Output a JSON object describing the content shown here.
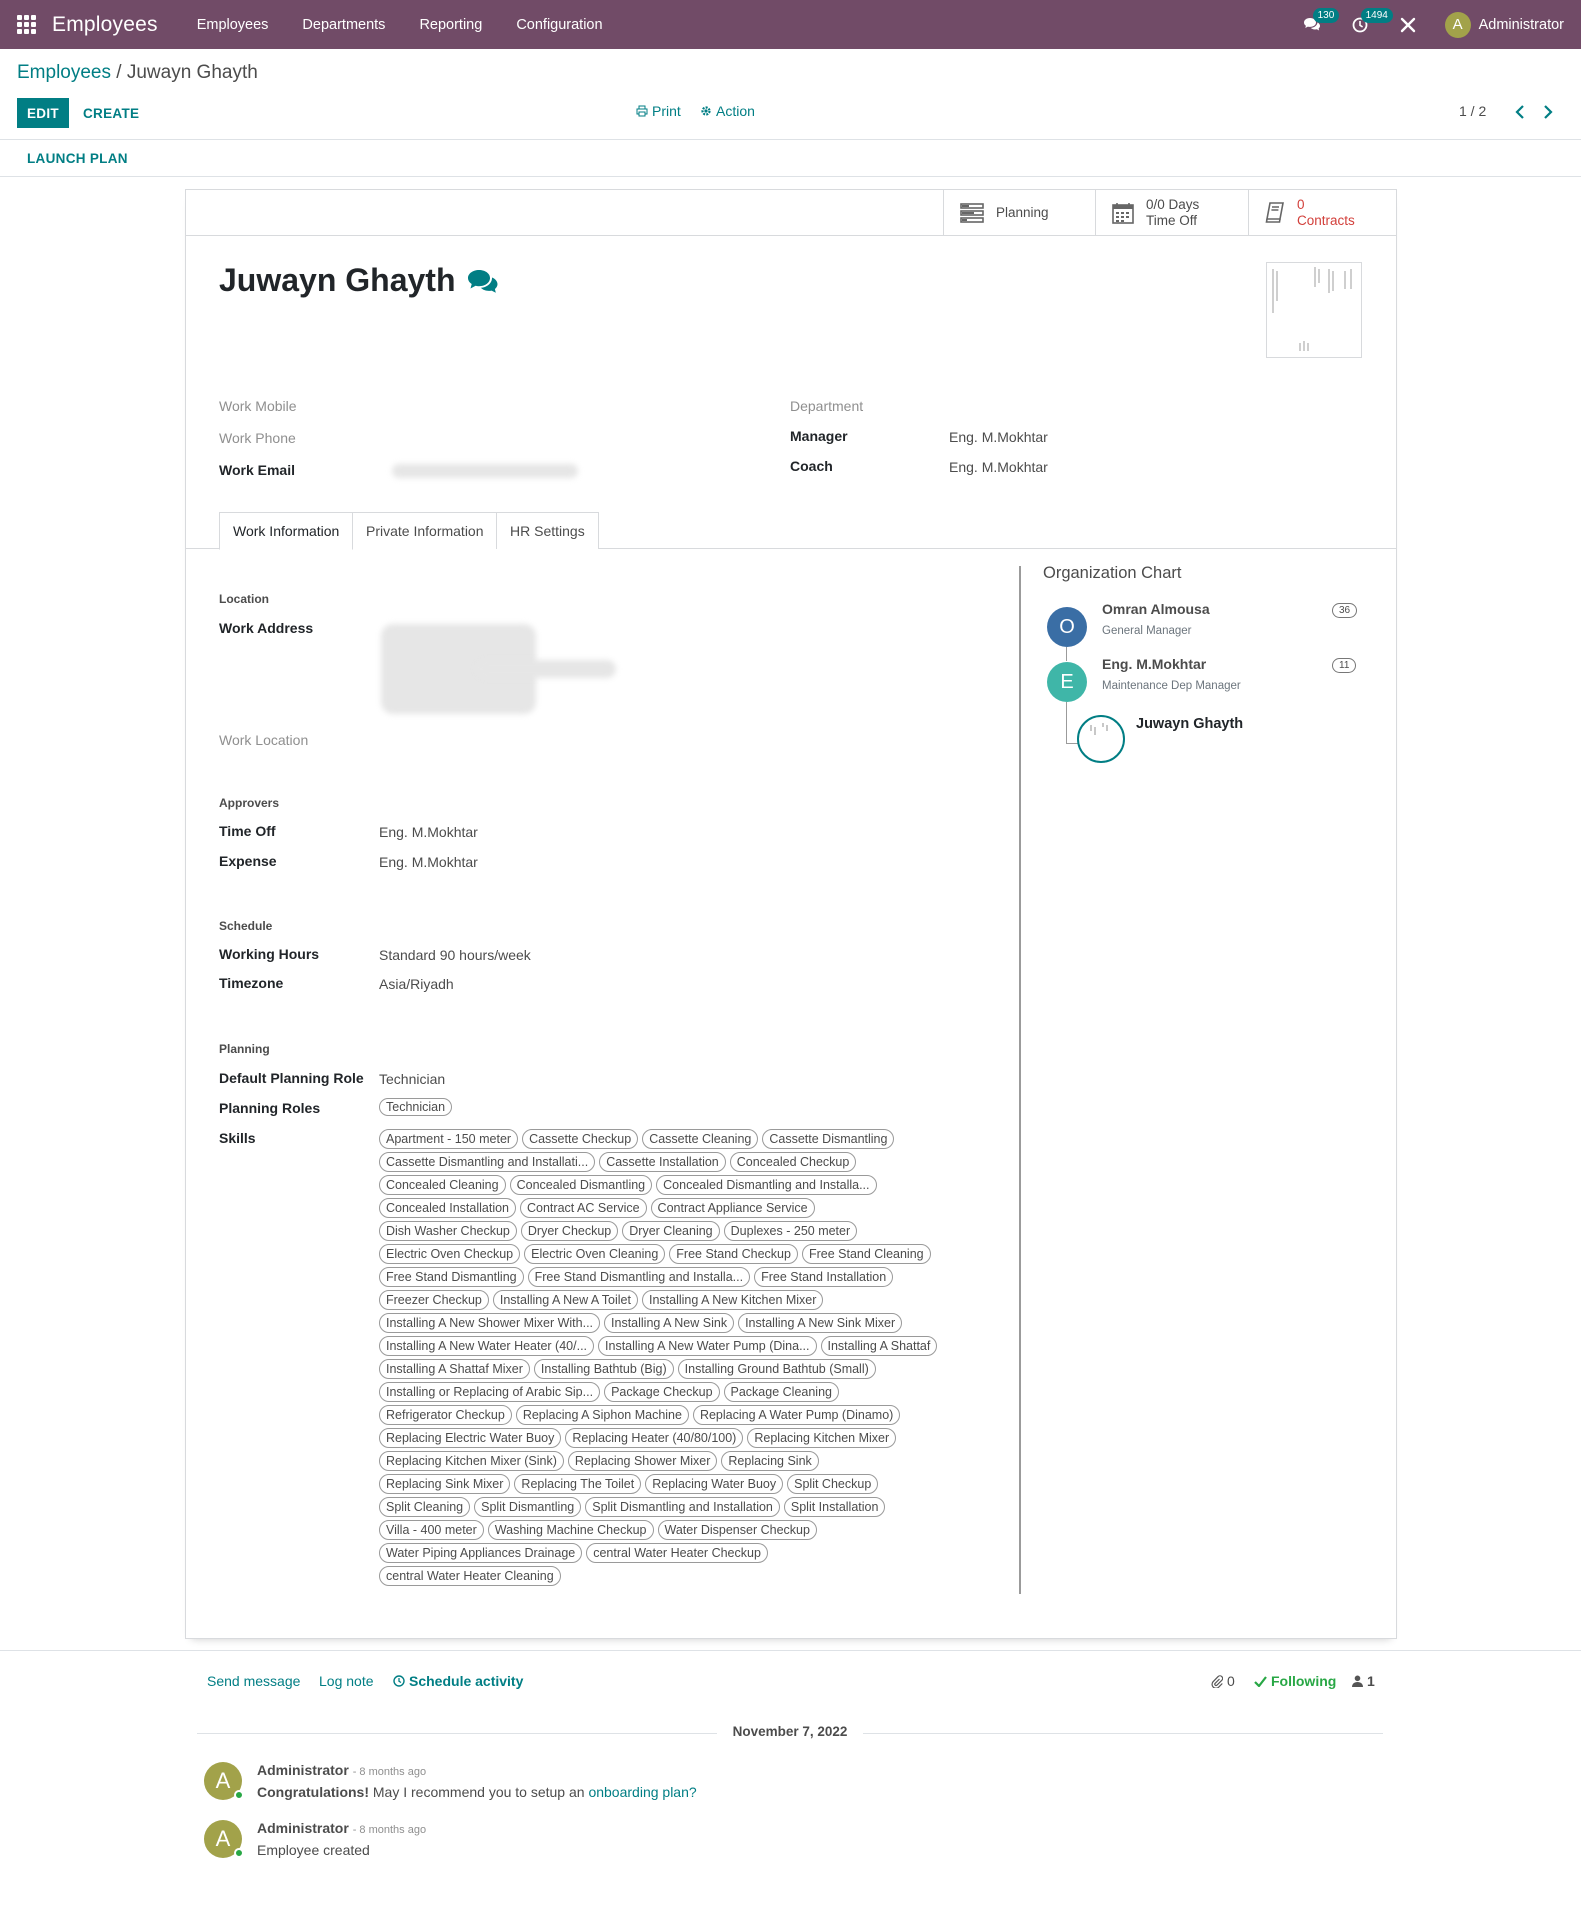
{
  "navbar": {
    "app_title": "Employees",
    "menu": [
      "Employees",
      "Departments",
      "Reporting",
      "Configuration"
    ],
    "messages_count": "130",
    "activities_count": "1494",
    "user_initial": "A",
    "user_name": "Administrator",
    "bg_color": "#714b67"
  },
  "control": {
    "breadcrumb_root": "Employees",
    "breadcrumb_sep": " / ",
    "breadcrumb_current": "Juwayn Ghayth",
    "edit_label": "EDIT",
    "create_label": "CREATE",
    "print_label": "Print",
    "action_label": "Action",
    "pager": "1 / 2",
    "launch_plan_label": "LAUNCH PLAN"
  },
  "smart_buttons": {
    "planning": "Planning",
    "timeoff_value": "0/0 Days",
    "timeoff_label": "Time Off",
    "contracts_value": "0",
    "contracts_label": "Contracts"
  },
  "employee": {
    "name": "Juwayn Ghayth"
  },
  "fields": {
    "work_mobile_label": "Work Mobile",
    "work_phone_label": "Work Phone",
    "work_email_label": "Work Email",
    "department_label": "Department",
    "manager_label": "Manager",
    "manager_value": "Eng. M.Mokhtar",
    "coach_label": "Coach",
    "coach_value": "Eng. M.Mokhtar"
  },
  "tabs": [
    "Work Information",
    "Private Information",
    "HR Settings"
  ],
  "work_info": {
    "location_title": "Location",
    "work_address_label": "Work Address",
    "work_location_label": "Work Location",
    "approvers_title": "Approvers",
    "time_off_label": "Time Off",
    "time_off_value": "Eng. M.Mokhtar",
    "expense_label": "Expense",
    "expense_value": "Eng. M.Mokhtar",
    "schedule_title": "Schedule",
    "working_hours_label": "Working Hours",
    "working_hours_value": "Standard 90 hours/week",
    "timezone_label": "Timezone",
    "timezone_value": "Asia/Riyadh",
    "planning_title": "Planning",
    "default_role_label": "Default Planning Role",
    "default_role_value": "Technician",
    "planning_roles_label": "Planning Roles",
    "planning_roles": [
      "Technician"
    ],
    "skills_label": "Skills",
    "skills": [
      "Apartment - 150 meter",
      "Cassette Checkup",
      "Cassette Cleaning",
      "Cassette Dismantling",
      "Cassette Dismantling and Installati...",
      "Cassette Installation",
      "Concealed Checkup",
      "Concealed Cleaning",
      "Concealed Dismantling",
      "Concealed Dismantling and Installa...",
      "Concealed Installation",
      "Contract AC Service",
      "Contract Appliance Service",
      "Dish Washer Checkup",
      "Dryer Checkup",
      "Dryer Cleaning",
      "Duplexes - 250 meter",
      "Electric Oven Checkup",
      "Electric Oven Cleaning",
      "Free Stand Checkup",
      "Free Stand Cleaning",
      "Free Stand Dismantling",
      "Free Stand Dismantling and Installa...",
      "Free Stand Installation",
      "Freezer Checkup",
      "Installing A New A Toilet",
      "Installing A New Kitchen Mixer",
      "Installing A New Shower Mixer With...",
      "Installing A New Sink",
      "Installing A New Sink Mixer",
      "Installing A New Water Heater (40/...",
      "Installing A New Water Pump (Dina...",
      "Installing A Shattaf",
      "Installing A Shattaf Mixer",
      "Installing Bathtub (Big)",
      "Installing Ground Bathtub (Small)",
      "Installing or Replacing of Arabic Sip...",
      "Package Checkup",
      "Package Cleaning",
      "Refrigerator Checkup",
      "Replacing A Siphon Machine",
      "Replacing A Water Pump (Dinamo)",
      "Replacing Electric Water Buoy",
      "Replacing Heater (40/80/100)",
      "Replacing Kitchen Mixer",
      "Replacing Kitchen Mixer (Sink)",
      "Replacing Shower Mixer",
      "Replacing Sink",
      "Replacing Sink Mixer",
      "Replacing The Toilet",
      "Replacing Water Buoy",
      "Split Checkup",
      "Split Cleaning",
      "Split Dismantling",
      "Split Dismantling and Installation",
      "Split Installation",
      "Villa - 400 meter",
      "Washing Machine Checkup",
      "Water Dispenser Checkup",
      "Water Piping Appliances Drainage",
      "central Water Heater Checkup",
      "central Water Heater Cleaning"
    ]
  },
  "org_chart": {
    "title": "Organization Chart",
    "people": [
      {
        "initial": "O",
        "name": "Omran Almousa",
        "job": "General Manager",
        "count": "36",
        "color": "#3a6ea5"
      },
      {
        "initial": "E",
        "name": "Eng. M.Mokhtar",
        "job": "Maintenance Dep Manager",
        "count": "11",
        "color": "#3fb6a8"
      },
      {
        "name": "Juwayn Ghayth"
      }
    ]
  },
  "chatter": {
    "send_message": "Send message",
    "log_note": "Log note",
    "schedule_activity": "Schedule activity",
    "attachments": "0",
    "following": "Following",
    "followers": "1",
    "date": "November 7, 2022",
    "messages": [
      {
        "initial": "A",
        "author": "Administrator",
        "time": "- 8 months ago",
        "bold": "Congratulations!",
        "text": " May I recommend you to setup an ",
        "link": "onboarding plan?"
      },
      {
        "initial": "A",
        "author": "Administrator",
        "time": "- 8 months ago",
        "text": "Employee created"
      }
    ]
  }
}
